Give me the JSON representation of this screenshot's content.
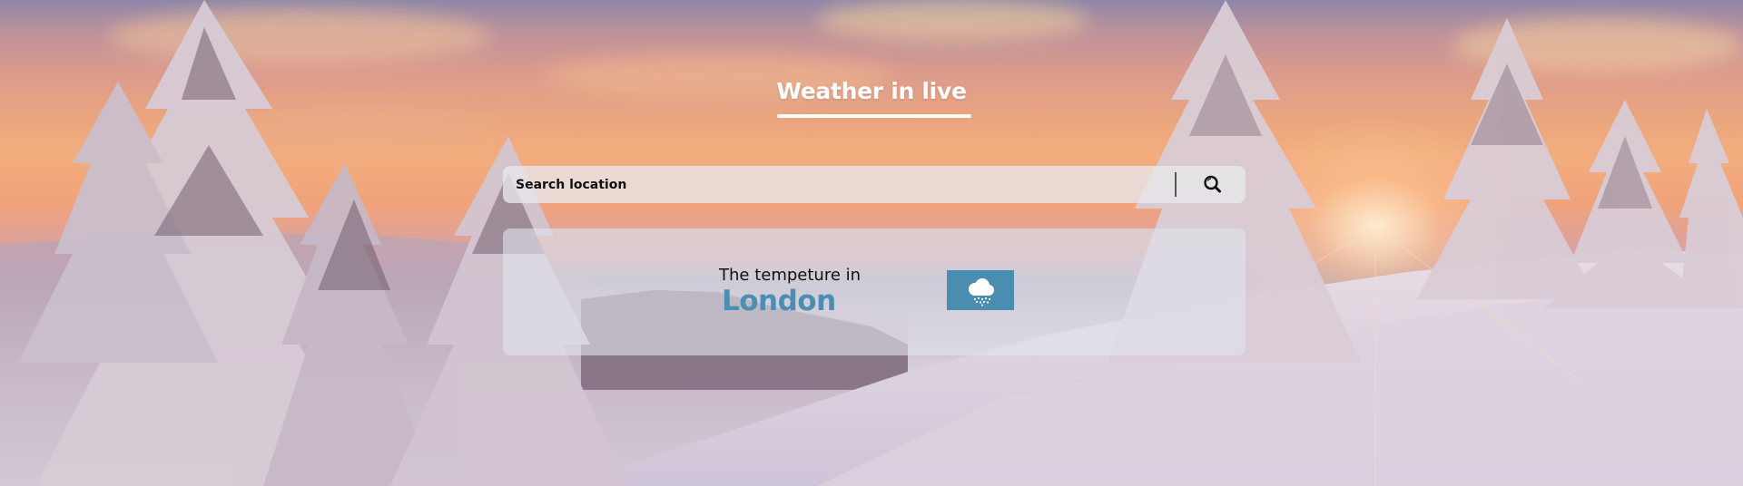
{
  "header": {
    "title": "Weather in live"
  },
  "search": {
    "placeholder": "Search location",
    "value": "",
    "button_icon": "search-icon"
  },
  "weather_card": {
    "label": "The tempeture in",
    "city": "London",
    "condition_icon": "cloud-snow-icon"
  },
  "theme": {
    "accent": "#4c8db4",
    "icon_box": "#4a8db0",
    "title_color": "#ffffff"
  }
}
